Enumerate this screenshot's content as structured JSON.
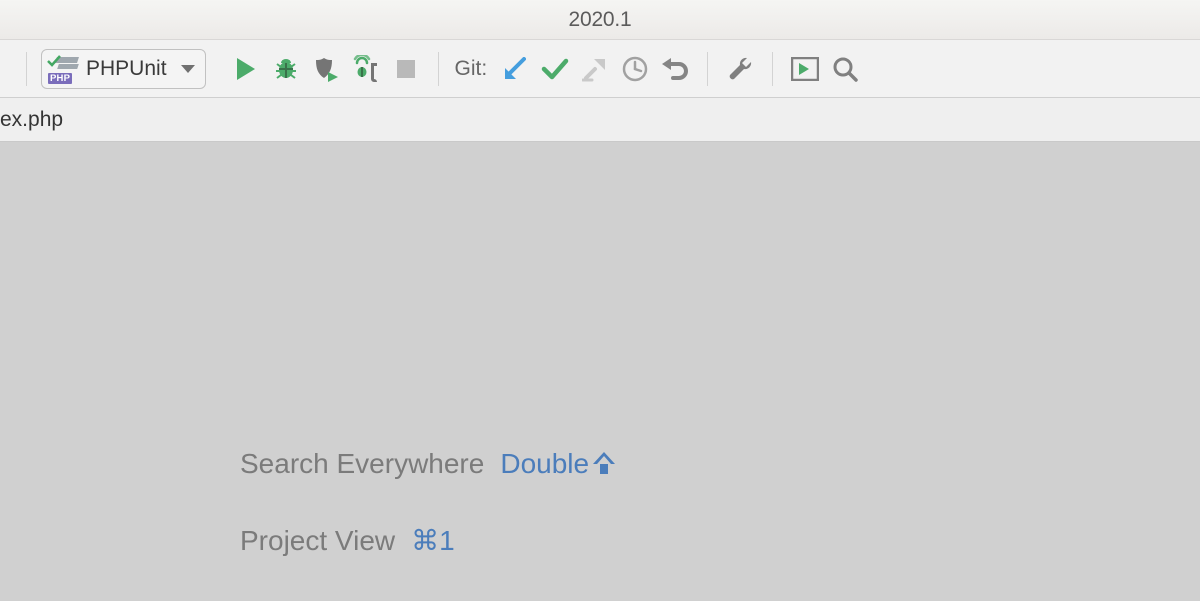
{
  "window": {
    "title": "2020.1"
  },
  "toolbar": {
    "run_config": {
      "label": "PHPUnit",
      "badge_text": "PHP"
    },
    "git_label": "Git:"
  },
  "tabbar": {
    "visible_filename": "ex.php"
  },
  "empty_state": {
    "hints": [
      {
        "label": "Search Everywhere",
        "key_prefix": "Double",
        "key_symbol": "shift"
      },
      {
        "label": "Project View",
        "key_prefix": "⌘1",
        "key_symbol": ""
      }
    ]
  },
  "colors": {
    "run_green": "#44a863",
    "debug_green": "#44a863",
    "icon_gray": "#6f6f6f",
    "git_blue": "#3c9add",
    "git_green": "#44a863",
    "link_blue": "#4b7dbb",
    "disabled_gray": "#a9a9a9"
  }
}
